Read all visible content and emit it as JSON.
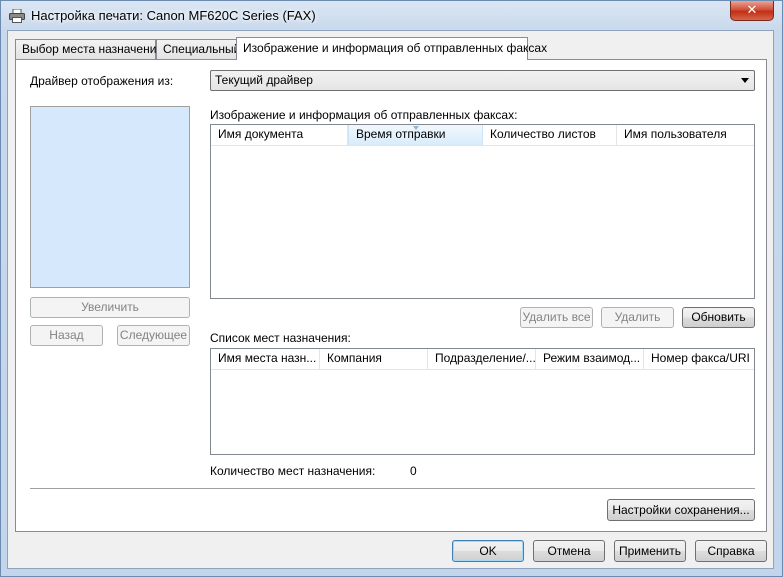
{
  "window": {
    "title": "Настройка печати: Canon MF620C Series (FAX)",
    "close_label": "✕"
  },
  "tabs": [
    {
      "label": "Выбор места назначения"
    },
    {
      "label": "Специальный"
    },
    {
      "label": "Изображение и информация об отправленных факсах"
    }
  ],
  "driver": {
    "label": "Драйвер отображения из:",
    "selected": "Текущий драйвер"
  },
  "preview": {
    "zoom_button": "Увеличить",
    "back_button": "Назад",
    "next_button": "Следующее"
  },
  "sent_faxes": {
    "label": "Изображение и информация об отправленных факсах:",
    "columns": [
      "Имя документа",
      "Время отправки",
      "Количество листов",
      "Имя пользователя"
    ],
    "rows": [],
    "delete_all_button": "Удалить все",
    "delete_button": "Удалить",
    "refresh_button": "Обновить"
  },
  "destinations": {
    "label": "Список мест назначения:",
    "columns": [
      "Имя места назн...",
      "Компания",
      "Подразделение/...",
      "Режим взаимод...",
      "Номер факса/URI"
    ],
    "rows": [],
    "count_label": "Количество мест назначения:",
    "count_value": "0"
  },
  "save_settings_button": "Настройки сохранения...",
  "footer": {
    "ok": "OK",
    "cancel": "Отмена",
    "apply": "Применить",
    "help": "Справка"
  },
  "colors": {
    "accent": "#3c7fb1",
    "preview_bg": "#d6e8fb",
    "close_button": "#c12f14"
  },
  "icons": {
    "title": "printer-icon",
    "close": "close-icon",
    "combo": "chevron-down-icon",
    "sort": "sort-indicator-icon"
  }
}
